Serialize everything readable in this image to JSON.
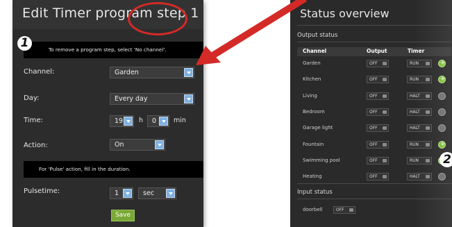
{
  "left_panel": {
    "title": "Edit Timer program step 1",
    "marker": "1",
    "note_remove": "To remove a program step, select 'No channel'.",
    "channel_label": "Channel:",
    "channel_value": "Garden",
    "day_label": "Day:",
    "day_value": "Every day",
    "time_label": "Time:",
    "time_hour": "19",
    "time_h_unit": "h",
    "time_minute": "0",
    "time_min_unit": "min",
    "action_label": "Action:",
    "action_value": "On",
    "note_pulse": "For 'Pulse' action, fill in the duration.",
    "pulsetime_label": "Pulsetime:",
    "pulsetime_value": "1",
    "pulsetime_unit": "sec",
    "save_label": "Save"
  },
  "right_panel": {
    "title": "Status overview",
    "output_section": "Output status",
    "col_channel": "Channel",
    "col_output": "Output",
    "col_timer": "Timer",
    "rows": [
      {
        "channel": "Garden",
        "output": "OFF",
        "timer": "RUN",
        "led": "on"
      },
      {
        "channel": "Kitchen",
        "output": "OFF",
        "timer": "RUN",
        "led": "on"
      },
      {
        "channel": "Living",
        "output": "OFF",
        "timer": "HALT",
        "led": "off"
      },
      {
        "channel": "Bedroom",
        "output": "OFF",
        "timer": "HALT",
        "led": "off"
      },
      {
        "channel": "Garage light",
        "output": "OFF",
        "timer": "HALT",
        "led": "off"
      },
      {
        "channel": "Fountain",
        "output": "OFF",
        "timer": "RUN",
        "led": "on"
      },
      {
        "channel": "Swimming pool",
        "output": "OFF",
        "timer": "RUN",
        "led": "on"
      },
      {
        "channel": "Heating",
        "output": "OFF",
        "timer": "HALT",
        "led": "off"
      }
    ],
    "input_section": "Input status",
    "input_name": "doorbell",
    "input_value": "OFF",
    "marker": "2"
  },
  "colors": {
    "accent_red": "#d42a27",
    "led_on": "#7cbe3a",
    "save_green": "#79a934",
    "select_arrow": "#7fb0e0"
  }
}
